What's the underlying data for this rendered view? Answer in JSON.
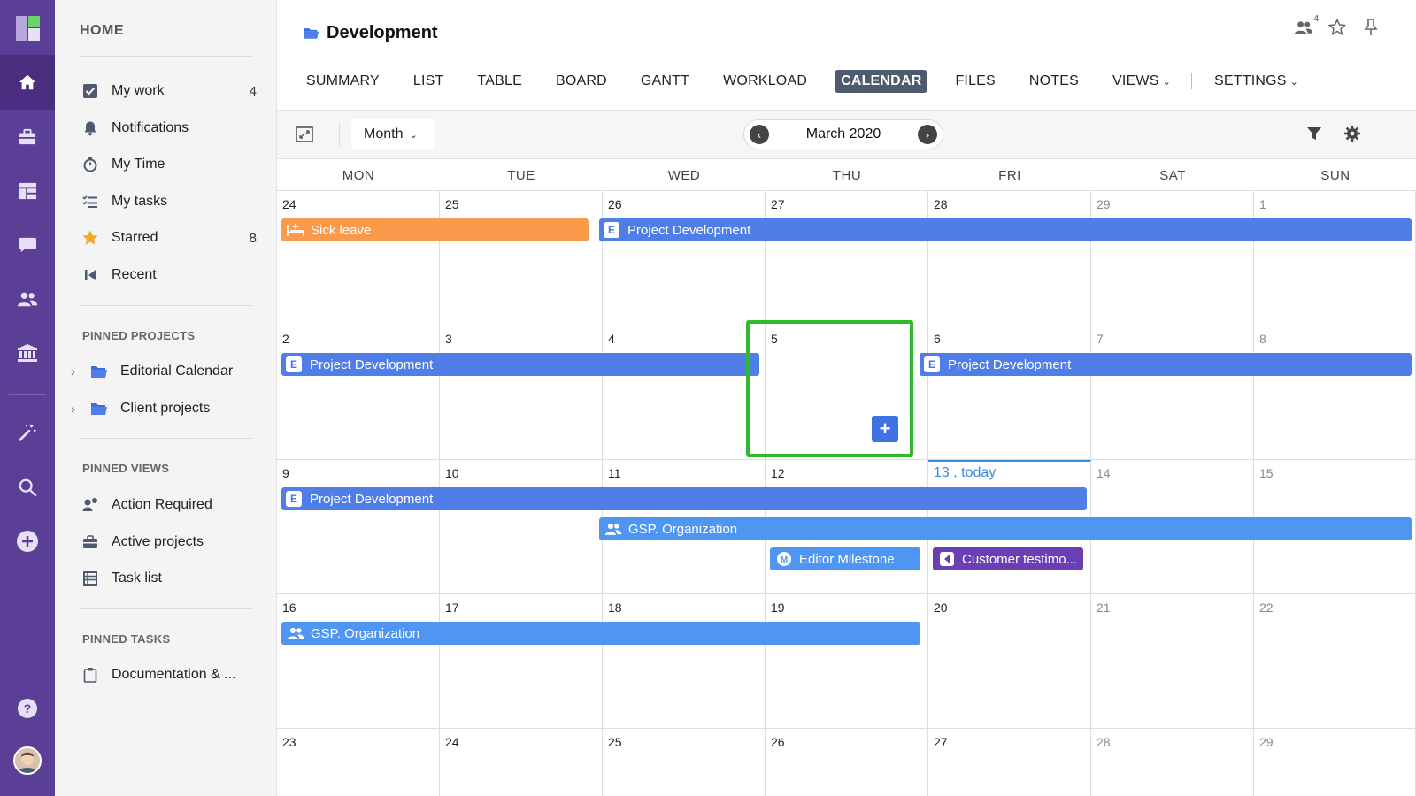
{
  "sidebar": {
    "home_label": "HOME",
    "items": [
      {
        "label": "My work",
        "count": "4"
      },
      {
        "label": "Notifications",
        "count": ""
      },
      {
        "label": "My Time",
        "count": ""
      },
      {
        "label": "My tasks",
        "count": ""
      },
      {
        "label": "Starred",
        "count": "8"
      },
      {
        "label": "Recent",
        "count": ""
      }
    ],
    "pinned_projects_title": "PINNED PROJECTS",
    "pinned_projects": [
      {
        "label": "Editorial Calendar"
      },
      {
        "label": "Client projects"
      }
    ],
    "pinned_views_title": "PINNED VIEWS",
    "pinned_views": [
      {
        "label": "Action Required"
      },
      {
        "label": "Active projects"
      },
      {
        "label": "Task list"
      }
    ],
    "pinned_tasks_title": "PINNED TASKS",
    "pinned_tasks": [
      {
        "label": "Documentation & ..."
      }
    ]
  },
  "header": {
    "title": "Development",
    "users_count": "4",
    "tabs": [
      "SUMMARY",
      "LIST",
      "TABLE",
      "BOARD",
      "GANTT",
      "WORKLOAD",
      "CALENDAR",
      "FILES",
      "NOTES",
      "VIEWS",
      "SETTINGS"
    ],
    "active_tab": "CALENDAR"
  },
  "toolbar": {
    "view_mode": "Month",
    "current_month": "March 2020"
  },
  "calendar": {
    "weekdays": [
      "MON",
      "TUE",
      "WED",
      "THU",
      "FRI",
      "SAT",
      "SUN"
    ],
    "weeks": [
      [
        "24",
        "25",
        "26",
        "27",
        "28",
        "29",
        "1"
      ],
      [
        "2",
        "3",
        "4",
        "5",
        "6",
        "7",
        "8"
      ],
      [
        "9",
        "10",
        "11",
        "12",
        "13 , today",
        "14",
        "15"
      ],
      [
        "16",
        "17",
        "18",
        "19",
        "20",
        "21",
        "22"
      ],
      [
        "23",
        "24",
        "25",
        "26",
        "27",
        "28",
        "29"
      ]
    ],
    "events": [
      {
        "label": "Sick leave",
        "badge": "",
        "color": "#fb9a4a"
      },
      {
        "label": "Project Development",
        "badge": "E",
        "color": "#4f7ee8"
      },
      {
        "label": "Project Development",
        "badge": "E",
        "color": "#4f7ee8"
      },
      {
        "label": "Project Development",
        "badge": "E",
        "color": "#4f7ee8"
      },
      {
        "label": "Project Development",
        "badge": "E",
        "color": "#4f7ee8"
      },
      {
        "label": "GSP. Organization",
        "badge": "",
        "color": "#4f96f2"
      },
      {
        "label": "Editor Milestone",
        "badge": "M",
        "color": "#4f96f2"
      },
      {
        "label": "Customer testimo...",
        "badge": "",
        "color": "#6a3fb4"
      },
      {
        "label": "GSP. Organization",
        "badge": "",
        "color": "#4f96f2"
      }
    ],
    "add_button": "+"
  }
}
